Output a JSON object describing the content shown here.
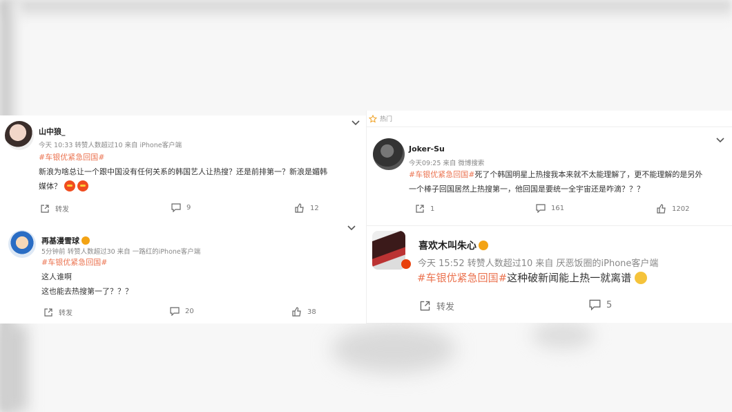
{
  "left": {
    "comments": [
      {
        "username": "山中狼_",
        "meta": "今天 10:33 转赞人数超过10  来自 iPhone客户端",
        "hashtag": "#车银优紧急回国#",
        "text_line1": "新浪为啥总让一个跟中国没有任何关系的韩国艺人让热搜？还是前排第一？新浪是媚韩",
        "text_line2": "媒体？",
        "actions": {
          "repost": "转发",
          "comment": "9",
          "like": "12"
        }
      },
      {
        "username": "再基漫雪球",
        "meta": "5分钟前 转赞人数超过30  来自 一路红的iPhone客户端",
        "hashtag": "#车银优紧急回国#",
        "text_line1": "这人谁啊",
        "text_line2": "这也能去热搜第一了？？？",
        "actions": {
          "repost": "转发",
          "comment": "20",
          "like": "38"
        }
      }
    ]
  },
  "right": {
    "header_label": "热门",
    "comments": [
      {
        "username": "Joker-Su",
        "meta": "今天09:25  来自 微博搜索",
        "hashtag": "#车银优紧急回国#",
        "text_line1": "死了个韩国明星上热搜我本来就不太能理解了，更不能理解的是另外",
        "text_line2": "一个棒子回国居然上热搜第一，他回国是要统一全宇宙还是咋滴？？？",
        "actions": {
          "repost": "1",
          "comment": "161",
          "like": "1202"
        }
      },
      {
        "username": "喜欢木叫朱心",
        "meta": "今天 15:52 转赞人数超过10  来自 厌恶饭圈的iPhone客户端",
        "hashtag": "#车银优紧急回国#",
        "text": "这种破新闻能上热一就离谱",
        "actions": {
          "repost": "转发",
          "comment": "5"
        }
      }
    ]
  },
  "colors": {
    "hashtag": "#eb7350",
    "text": "#333333",
    "meta": "#888888"
  }
}
